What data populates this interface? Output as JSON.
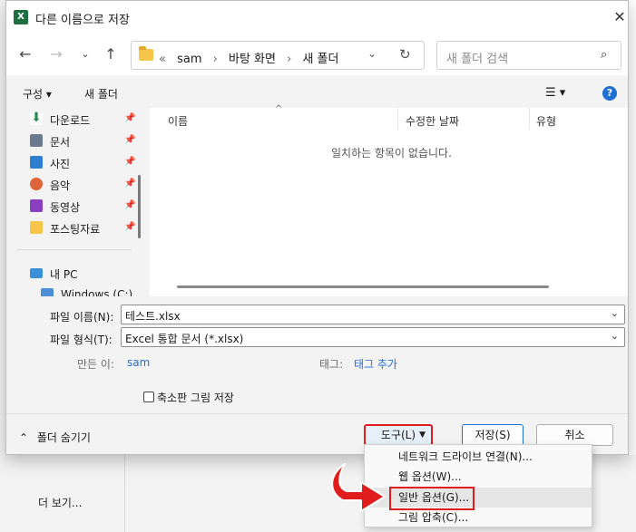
{
  "dialog": {
    "title": "다른 이름으로 저장",
    "app_icon_letter": "X"
  },
  "nav": {
    "breadcrumbs": [
      "«",
      "sam",
      "바탕 화면",
      "새 폴더"
    ],
    "search_placeholder": "새 폴더 검색"
  },
  "toolbar": {
    "organize_label": "구성 ▾",
    "new_folder_label": "새 폴더"
  },
  "sidebar": {
    "items": [
      {
        "label": "다운로드",
        "icon": "download-icon",
        "color": "#2a8a54"
      },
      {
        "label": "문서",
        "icon": "document-icon",
        "color": "#6b7a8f"
      },
      {
        "label": "사진",
        "icon": "pictures-icon",
        "color": "#2f7fd1"
      },
      {
        "label": "음악",
        "icon": "music-icon",
        "color": "#e0643a"
      },
      {
        "label": "동영상",
        "icon": "video-icon",
        "color": "#8a3fbf"
      },
      {
        "label": "포스팅자료",
        "icon": "folder-icon",
        "color": "#f6c54a"
      }
    ],
    "pc_label": "내 PC",
    "drive_label": "Windows (C:)"
  },
  "file_list": {
    "columns": [
      "이름",
      "수정한 날짜",
      "유형"
    ],
    "empty_message": "일치하는 항목이 없습니다."
  },
  "form": {
    "filename_label": "파일 이름(N):",
    "filename_value": "테스트.xlsx",
    "filetype_label": "파일 형식(T):",
    "filetype_value": "Excel 통합 문서 (*.xlsx)",
    "authors_label": "만든 이:",
    "authors_value": "sam",
    "tags_label": "태그:",
    "tags_value": "태그 추가",
    "thumbnail_label": "축소판 그림 저장"
  },
  "footer": {
    "hide_folders_label": "폴더 숨기기",
    "tools_label": "도구(L)",
    "save_label": "저장(S)",
    "cancel_label": "취소"
  },
  "tools_menu": {
    "items": [
      "네트워크 드라이브 연결(N)...",
      "웹 옵션(W)...",
      "일반 옵션(G)...",
      "그림 압축(C)..."
    ],
    "highlighted_index": 2
  },
  "background": {
    "more_label": "더 보기..."
  },
  "colors": {
    "accent": "#1f6ed4",
    "highlight_box": "#e01c1c",
    "excel_green": "#1d6f42"
  }
}
